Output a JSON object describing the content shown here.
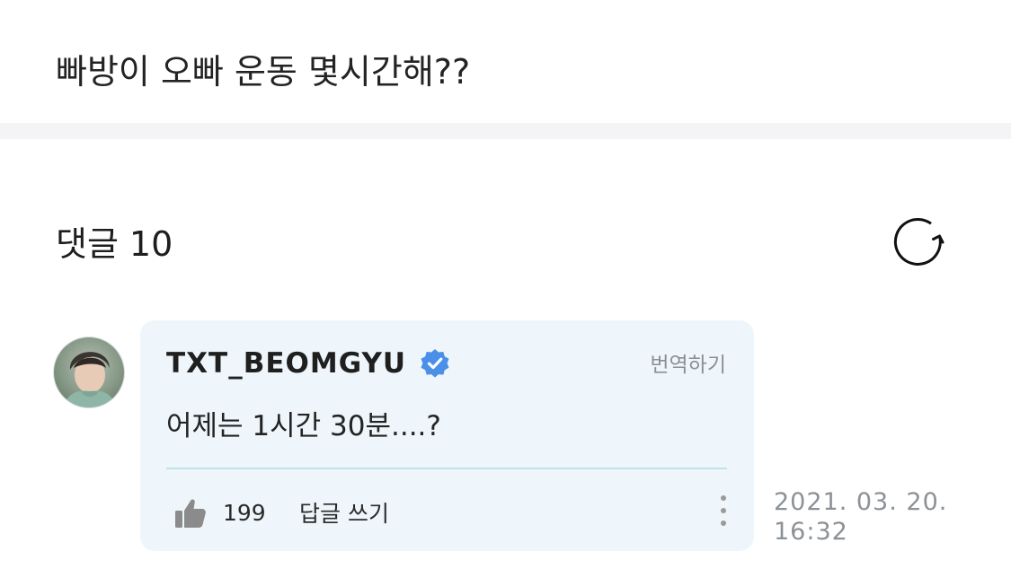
{
  "post": {
    "title": "빠방이 오빠 운동 몇시간해??"
  },
  "comments_section": {
    "label": "댓글",
    "count": "10",
    "refresh_icon": "refresh-icon"
  },
  "comment": {
    "author": "TXT_BEOMGYU",
    "verified_icon": "verified-badge-icon",
    "translate_label": "번역하기",
    "text": "어제는 1시간 30분....?",
    "likes": "199",
    "like_icon": "thumbs-up-icon",
    "reply_label": "답글 쓰기",
    "more_icon": "more-vertical-icon",
    "date": "2021. 03. 20.",
    "time": "16:32"
  },
  "colors": {
    "card_background": "#eef6fb",
    "verified_blue": "#4a8fe8",
    "divider_accent": "#bfe1e8",
    "muted_text": "#8c9196"
  }
}
